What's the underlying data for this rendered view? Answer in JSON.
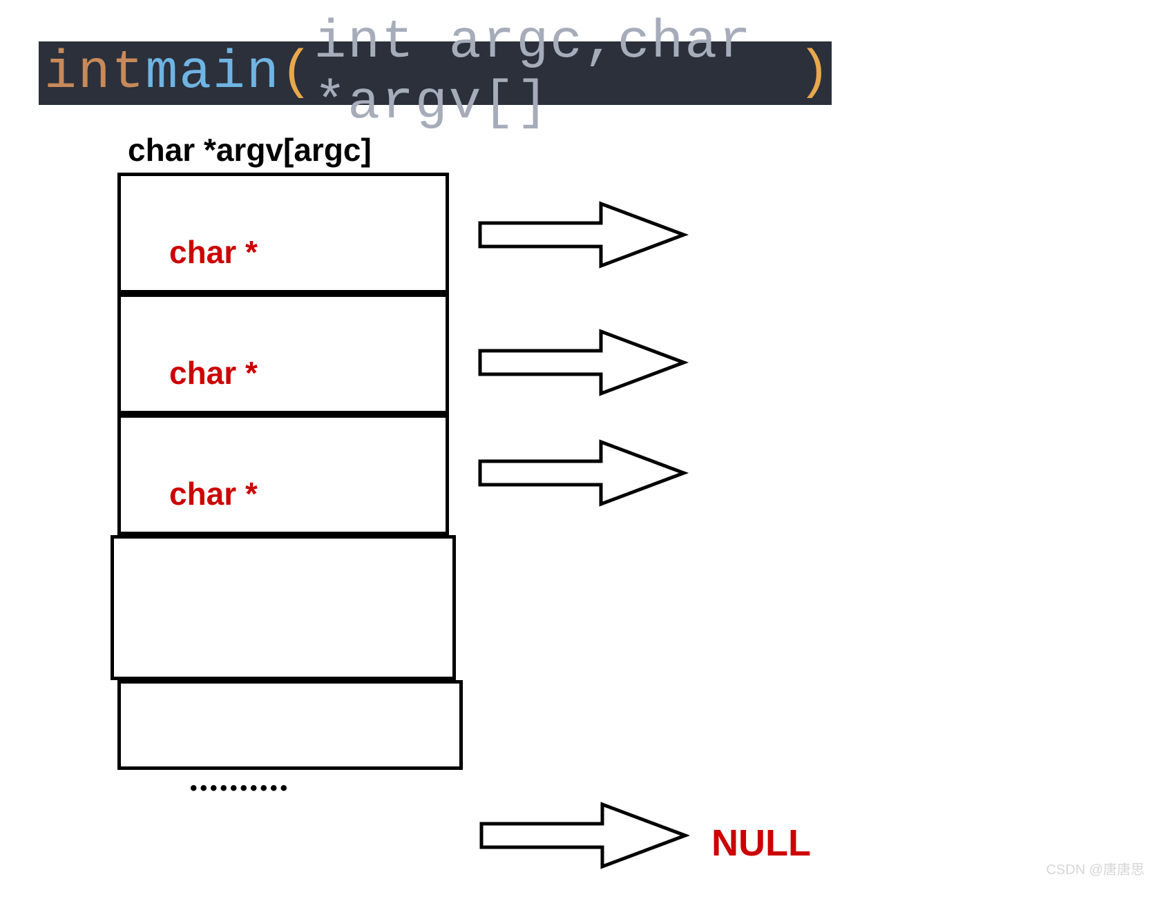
{
  "code": {
    "type_kw": "int ",
    "func_name": "main",
    "open_paren": "(",
    "args": "int argc,char *argv[]",
    "close_paren": ")"
  },
  "array_title": "char *argv[argc]",
  "cells": [
    {
      "label": "char *"
    },
    {
      "label": "char *"
    },
    {
      "label": "char *"
    },
    {
      "label": ""
    },
    {
      "label": ""
    }
  ],
  "dots": "••••••••••",
  "null_text": "NULL",
  "watermark": "CSDN @唐唐思",
  "diagram": {
    "description": "Diagram of the argv array of char pointers. Each slot in char *argv[argc] holds a char * that points to a command-line argument string, with the array terminated by NULL.",
    "arrow_count": 4
  }
}
